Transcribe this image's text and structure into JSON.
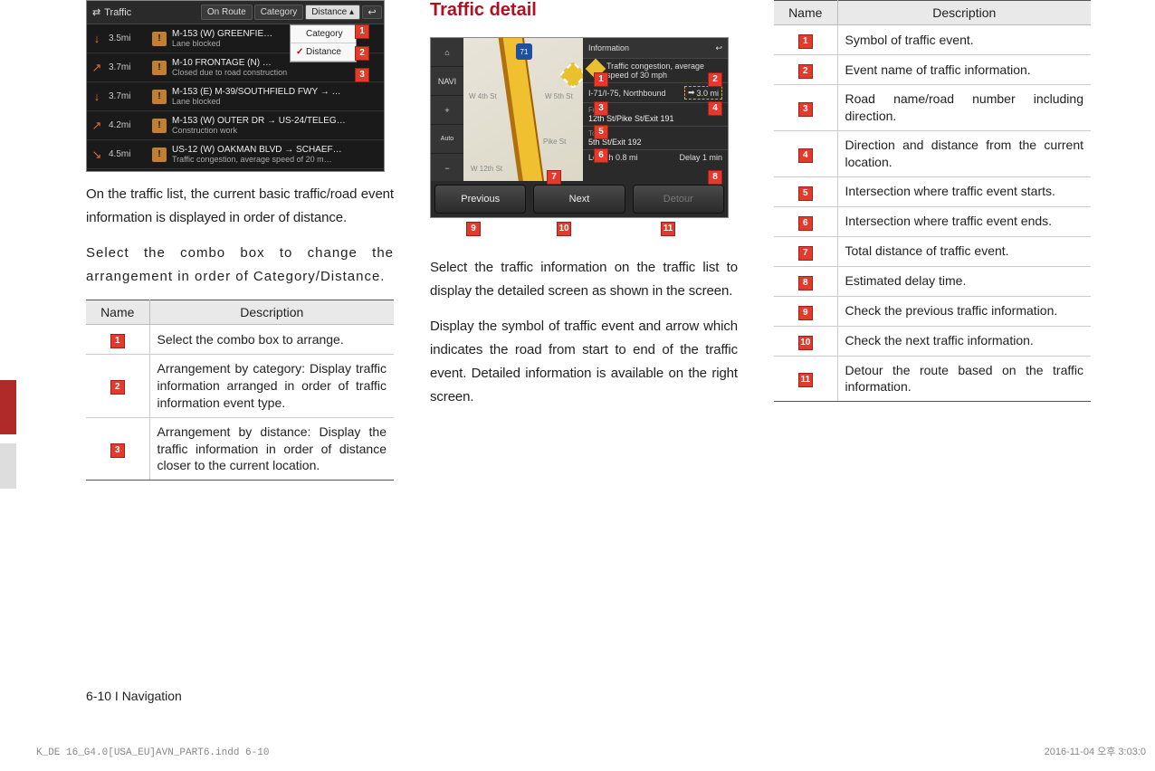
{
  "col1": {
    "traffic_header": "Traffic",
    "tabs": {
      "onroute": "On Route",
      "category": "Category",
      "distance": "Distance ▴"
    },
    "dropdown": {
      "opt1": "Category",
      "opt2": "Distance"
    },
    "rows": [
      {
        "arrow": "↓",
        "dist": "3.5mi",
        "t1": "M-153 (W) GREENFIE…",
        "t2": "Lane blocked"
      },
      {
        "arrow": "↗",
        "dist": "3.7mi",
        "t1": "M-10 FRONTAGE (N) …",
        "t2": "Closed due to road construction"
      },
      {
        "arrow": "↓",
        "dist": "3.7mi",
        "t1": "M-153 (E) M-39/SOUTHFIELD FWY → …",
        "t2": "Lane blocked"
      },
      {
        "arrow": "↗",
        "dist": "4.2mi",
        "t1": "M-153 (W) OUTER DR → US-24/TELEG…",
        "t2": "Construction work"
      },
      {
        "arrow": "↘",
        "dist": "4.5mi",
        "t1": "US-12 (W) OAKMAN BLVD → SCHAEF…",
        "t2": "Traffic congestion, average speed of 20 m…"
      }
    ],
    "para1": "On the traffic list, the current basic traffic/road event information is displayed in order of distance.",
    "para2": "Select the combo box to change the arrangement in order of Category/Distance.",
    "table": {
      "h1": "Name",
      "h2": "Description",
      "r1": "Select the combo box to arrange.",
      "r2": "Arrangement by category: Display traffic information arranged in order of traffic information event type.",
      "r3": "Arrangement by distance: Display the traffic information in order of distance closer to the current location."
    }
  },
  "col2": {
    "title": "Traffic detail",
    "info_hdr": "Information",
    "event_text": "Traffic congestion, average speed of 30 mph",
    "road": "I-71/I-75, Northbound",
    "road_dist": "3.0 mi",
    "from_lbl": "From",
    "from_val": "12th St/Pike St/Exit 191",
    "to_lbl": "To",
    "to_val": "5th St/Exit 192",
    "len_lbl": "Length",
    "len_val": "0.8 mi",
    "delay_lbl": "Delay",
    "delay_val": "1 min",
    "btn_prev": "Previous",
    "btn_next": "Next",
    "btn_detour": "Detour",
    "map_labels": {
      "w4th": "W 4th St",
      "w5th": "W 5th St",
      "pike": "Pike St",
      "w12th": "W 12th St",
      "shield": "71"
    },
    "left_btns": {
      "home": "⌂",
      "navi": "NAVI",
      "plus": "+",
      "auto": "Auto",
      "minus": "−"
    },
    "para1": "Select the traffic information on the traffic list to display the detailed screen as shown in the screen.",
    "para2": "Display the symbol of traffic event and arrow which indicates the road from start to end of the traffic event. Detailed information is available on the right screen."
  },
  "col3": {
    "h1": "Name",
    "h2": "Description",
    "rows": [
      "Symbol of traffic event.",
      "Event name of traffic information.",
      "Road name/road number including direction.",
      "Direction and distance from the current location.",
      "Intersection where traffic event starts.",
      "Intersection where traffic event ends.",
      "Total distance of traffic event.",
      "Estimated delay time.",
      "Check the previous traffic information.",
      "Check the next traffic information.",
      "Detour the route based on the traffic information."
    ]
  },
  "badges": {
    "n1": "1",
    "n2": "2",
    "n3": "3",
    "n4": "4",
    "n5": "5",
    "n6": "6",
    "n7": "7",
    "n8": "8",
    "n9": "9",
    "n10": "10",
    "n11": "11"
  },
  "footer": {
    "page": "6-10 I Navigation",
    "indd": "K_DE 16_G4.0[USA_EU]AVN_PART6.indd   6-10",
    "date": "2016-11-04   오후 3:03:0"
  }
}
